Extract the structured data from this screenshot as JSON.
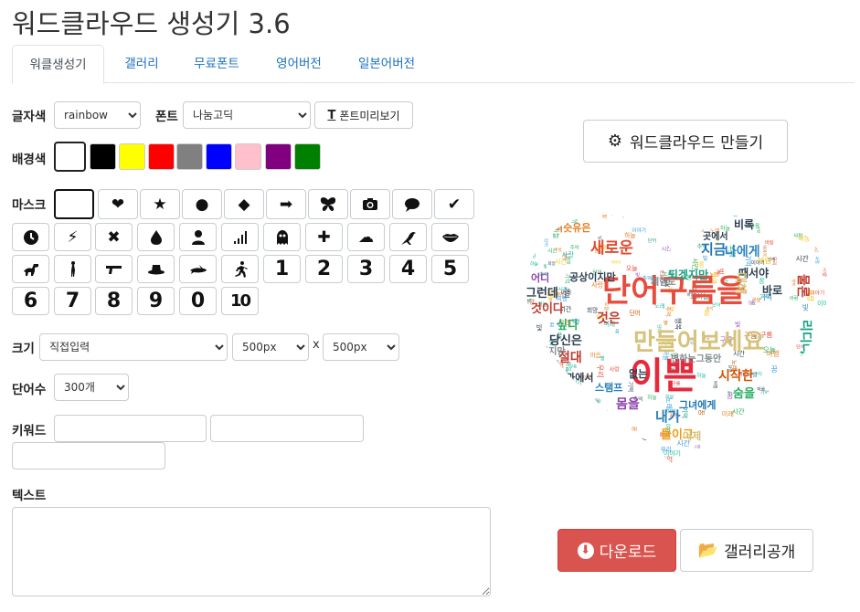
{
  "app": {
    "title": "워드클라우드 생성기 3.6"
  },
  "tabs": [
    {
      "label": "워클생성기",
      "active": true
    },
    {
      "label": "갤러리"
    },
    {
      "label": "무료폰트"
    },
    {
      "label": "영어버전"
    },
    {
      "label": "일본어버전"
    }
  ],
  "form": {
    "font_color_label": "글자색",
    "font_color_value": "rainbow",
    "font_label": "폰트",
    "font_value": "나눔고딕",
    "font_preview_label": "폰트미리보기",
    "bg_label": "배경색",
    "bg_colors": [
      "#ffffff",
      "#000000",
      "#ffff00",
      "#ff0000",
      "#808080",
      "#0000ff",
      "#ffc0cb",
      "#800080",
      "#008000"
    ],
    "mask_label": "마스크",
    "size_label": "크기",
    "size_mode": "직접입력",
    "width_value": "500px",
    "size_sep": "x",
    "height_value": "500px",
    "word_count_label": "단어수",
    "word_count_value": "300개",
    "keyword_label": "키워드",
    "keywords": [
      "",
      "",
      ""
    ],
    "text_label": "텍스트",
    "text_value": ""
  },
  "masks": [
    {
      "name": "blank",
      "glyph": ""
    },
    {
      "name": "heart",
      "glyph": "❤"
    },
    {
      "name": "star",
      "glyph": "★"
    },
    {
      "name": "circle",
      "glyph": "●"
    },
    {
      "name": "diamond",
      "glyph": "◆"
    },
    {
      "name": "arrow",
      "glyph": "➡"
    },
    {
      "name": "butterfly",
      "glyph": "svg"
    },
    {
      "name": "camera",
      "glyph": "svg"
    },
    {
      "name": "speech-bubble",
      "glyph": "svg"
    },
    {
      "name": "check",
      "glyph": "✔"
    },
    {
      "name": "clock",
      "glyph": "svg"
    },
    {
      "name": "lightning",
      "glyph": "⚡"
    },
    {
      "name": "x-mark",
      "glyph": "✖"
    },
    {
      "name": "drop",
      "glyph": "svg"
    },
    {
      "name": "person",
      "glyph": "svg"
    },
    {
      "name": "signal",
      "glyph": "svg"
    },
    {
      "name": "ghost",
      "glyph": "svg"
    },
    {
      "name": "plus",
      "glyph": "✚"
    },
    {
      "name": "cloud",
      "glyph": "☁"
    },
    {
      "name": "bird",
      "glyph": "svg"
    },
    {
      "name": "lips",
      "glyph": "svg"
    },
    {
      "name": "dinosaur",
      "glyph": "svg"
    },
    {
      "name": "figure",
      "glyph": "svg"
    },
    {
      "name": "gun",
      "glyph": "svg"
    },
    {
      "name": "hat",
      "glyph": "svg"
    },
    {
      "name": "shark",
      "glyph": "svg"
    },
    {
      "name": "runner",
      "glyph": "svg"
    },
    {
      "name": "num-1",
      "glyph": "1"
    },
    {
      "name": "num-2",
      "glyph": "2"
    },
    {
      "name": "num-3",
      "glyph": "3"
    },
    {
      "name": "num-4",
      "glyph": "4"
    },
    {
      "name": "num-5",
      "glyph": "5"
    },
    {
      "name": "num-6",
      "glyph": "6"
    },
    {
      "name": "num-7",
      "glyph": "7"
    },
    {
      "name": "num-8",
      "glyph": "8"
    },
    {
      "name": "num-9",
      "glyph": "9"
    },
    {
      "name": "num-0",
      "glyph": "0"
    },
    {
      "name": "num-10",
      "glyph": "10"
    }
  ],
  "actions": {
    "make_label": "워드클라우드 만들기",
    "download_label": "다운로드",
    "gallery_label": "갤러리공개"
  },
  "cloud": {
    "words": [
      {
        "t": "단어구름을",
        "c": "#e74c3c"
      },
      {
        "t": "만들어보세요",
        "c": "#d6c27a"
      },
      {
        "t": "이쁜",
        "c": "#e8283b"
      },
      {
        "t": "새로운",
        "c": "#e04a30"
      },
      {
        "t": "비슷유은",
        "c": "#e67e22"
      },
      {
        "t": "나에게",
        "c": "#2e86c1"
      },
      {
        "t": "지금",
        "c": "#1f77b4"
      },
      {
        "t": "되겠지만",
        "c": "#16a085"
      },
      {
        "t": "때서야",
        "c": "#2c3e50"
      },
      {
        "t": "물론",
        "c": "#c0392b"
      },
      {
        "t": "그런데",
        "c": "#2c3e50"
      },
      {
        "t": "것이다",
        "c": "#c0392b"
      },
      {
        "t": "싶다",
        "c": "#27ae60"
      },
      {
        "t": "당신은",
        "c": "#2c3e50"
      },
      {
        "t": "절대",
        "c": "#c0392b"
      },
      {
        "t": "시작한",
        "c": "#d35400"
      },
      {
        "t": "숨을",
        "c": "#27ae60"
      },
      {
        "t": "몸을",
        "c": "#8e44ad"
      },
      {
        "t": "내가",
        "c": "#2980b9"
      },
      {
        "t": "그녀에게",
        "c": "#1f77b4"
      },
      {
        "t": "들이고",
        "c": "#f39c12"
      },
      {
        "t": "공상이지만",
        "c": "#2c3e50"
      },
      {
        "t": "어디",
        "c": "#8e44ad"
      },
      {
        "t": "없는",
        "c": "#2c3e50"
      },
      {
        "t": "것은",
        "c": "#c0392b"
      },
      {
        "t": "바로",
        "c": "#2c3e50"
      },
      {
        "t": "하지만",
        "c": "#7f8c8d"
      },
      {
        "t": "왕과에서",
        "c": "#2c3e50"
      },
      {
        "t": "리디다",
        "c": "#16a085"
      },
      {
        "t": "곳에서",
        "c": "#2c3e50"
      },
      {
        "t": "비록",
        "c": "#2c3e50"
      },
      {
        "t": "대해",
        "c": "#d6c27a"
      },
      {
        "t": "어제",
        "c": "#d6c27a"
      },
      {
        "t": "스탬프",
        "c": "#2980b9"
      },
      {
        "t": "변하는그동안",
        "c": "#7f8c8d"
      },
      {
        "t": "체험도",
        "c": "#7f8c8d"
      }
    ]
  }
}
